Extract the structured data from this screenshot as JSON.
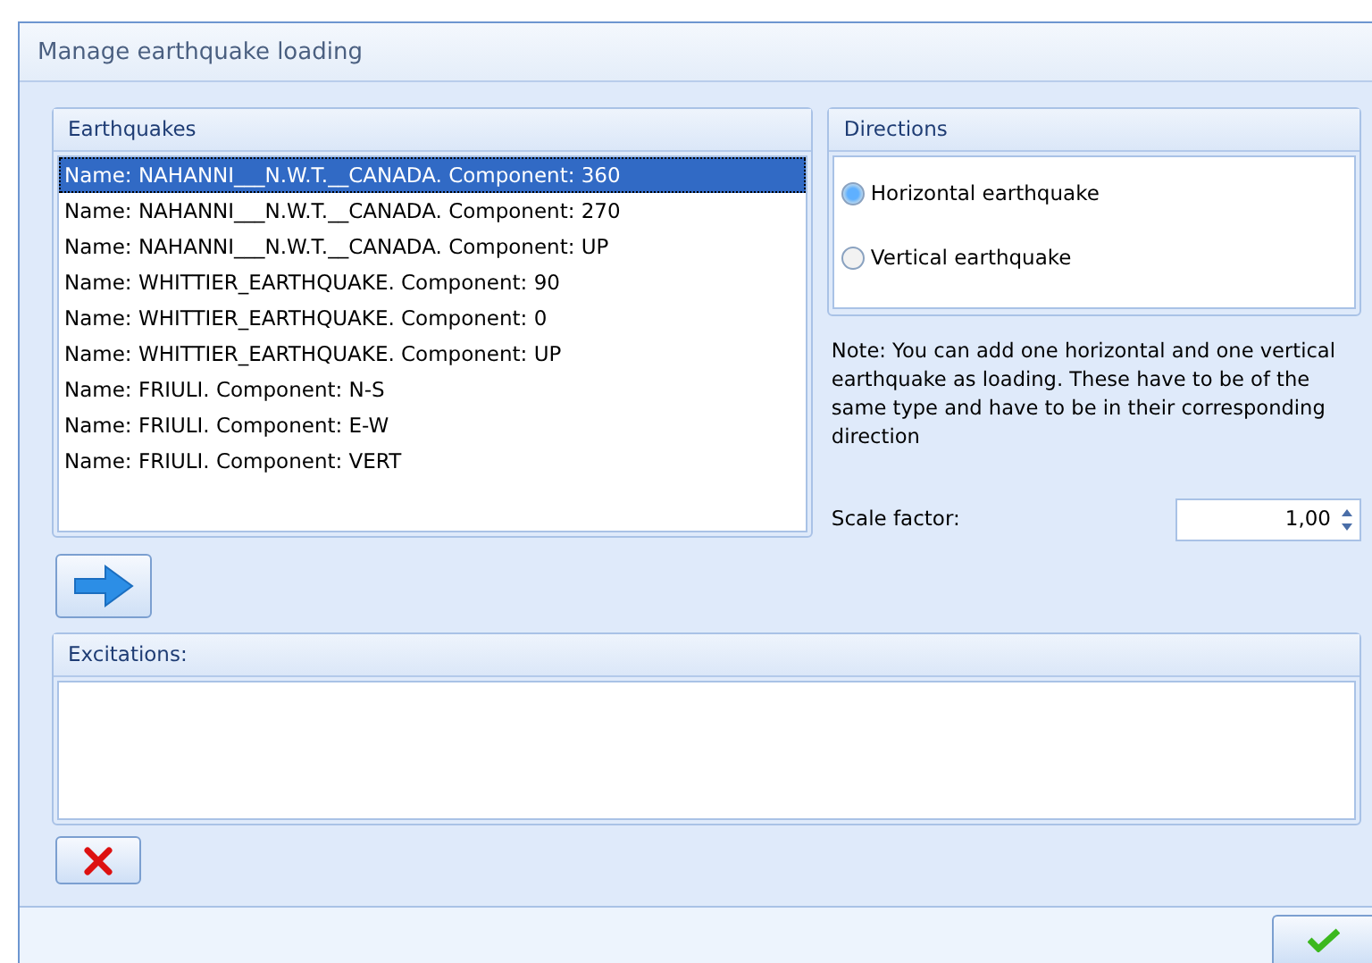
{
  "window": {
    "title": "Manage earthquake loading"
  },
  "earthquakes": {
    "title": "Earthquakes",
    "items": [
      {
        "label": "Name: NAHANNI___N.W.T.__CANADA. Component: 360",
        "selected": true
      },
      {
        "label": "Name: NAHANNI___N.W.T.__CANADA. Component: 270",
        "selected": false
      },
      {
        "label": "Name: NAHANNI___N.W.T.__CANADA. Component: UP",
        "selected": false
      },
      {
        "label": "Name: WHITTIER_EARTHQUAKE. Component: 90",
        "selected": false
      },
      {
        "label": "Name: WHITTIER_EARTHQUAKE. Component: 0",
        "selected": false
      },
      {
        "label": "Name: WHITTIER_EARTHQUAKE. Component: UP",
        "selected": false
      },
      {
        "label": "Name: FRIULI. Component: N-S",
        "selected": false
      },
      {
        "label": "Name: FRIULI. Component: E-W",
        "selected": false
      },
      {
        "label": "Name: FRIULI. Component: VERT",
        "selected": false
      }
    ]
  },
  "directions": {
    "title": "Directions",
    "options": [
      {
        "label": "Horizontal earthquake",
        "selected": true
      },
      {
        "label": "Vertical earthquake",
        "selected": false
      }
    ]
  },
  "note": "Note: You can add one horizontal and one vertical earthquake as loading. These have to be of the same type and have to be in their corresponding direction",
  "scale_factor": {
    "label": "Scale factor:",
    "value": "1,00"
  },
  "excitations": {
    "title": "Excitations:"
  }
}
